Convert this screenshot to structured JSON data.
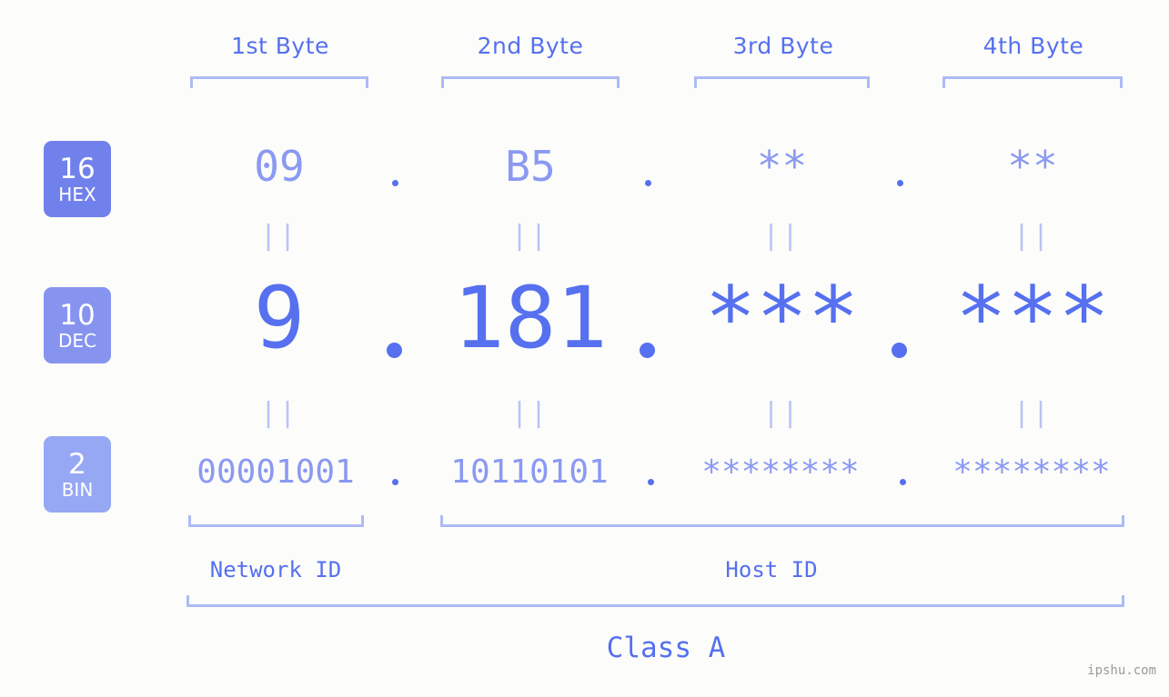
{
  "background_color": "#fcfdfa",
  "accent_color": "#5670ef",
  "muted_accent_color": "#8b99f2",
  "bracket_color": "#aebaf6",
  "headers": {
    "byte1": "1st Byte",
    "byte2": "2nd Byte",
    "byte3": "3rd Byte",
    "byte4": "4th Byte"
  },
  "bases": [
    {
      "num": "16",
      "abbr": "HEX",
      "color": "#7181ec"
    },
    {
      "num": "10",
      "abbr": "DEC",
      "color": "#8694f0"
    },
    {
      "num": "2",
      "abbr": "BIN",
      "color": "#96a7f4"
    }
  ],
  "rows": {
    "hex": {
      "base_label": "16",
      "base_abbr": "HEX",
      "octets": [
        "09",
        "B5",
        "**",
        "**"
      ],
      "separator": "."
    },
    "dec": {
      "base_label": "10",
      "base_abbr": "DEC",
      "octets": [
        "9",
        "181",
        "***",
        "***"
      ],
      "separator": "."
    },
    "bin": {
      "base_label": "2",
      "base_abbr": "BIN",
      "octets": [
        "00001001",
        "10110101",
        "********",
        "********"
      ],
      "separator": "."
    }
  },
  "equality_marks": {
    "symbol": "||",
    "hex_to_dec": [
      "||",
      "||",
      "||",
      "||"
    ],
    "dec_to_bin": [
      "||",
      "||",
      "||",
      "||"
    ]
  },
  "footer": {
    "network_id_label": "Network ID",
    "host_id_label": "Host ID",
    "class_label": "Class A"
  },
  "watermark": "ipshu.com"
}
